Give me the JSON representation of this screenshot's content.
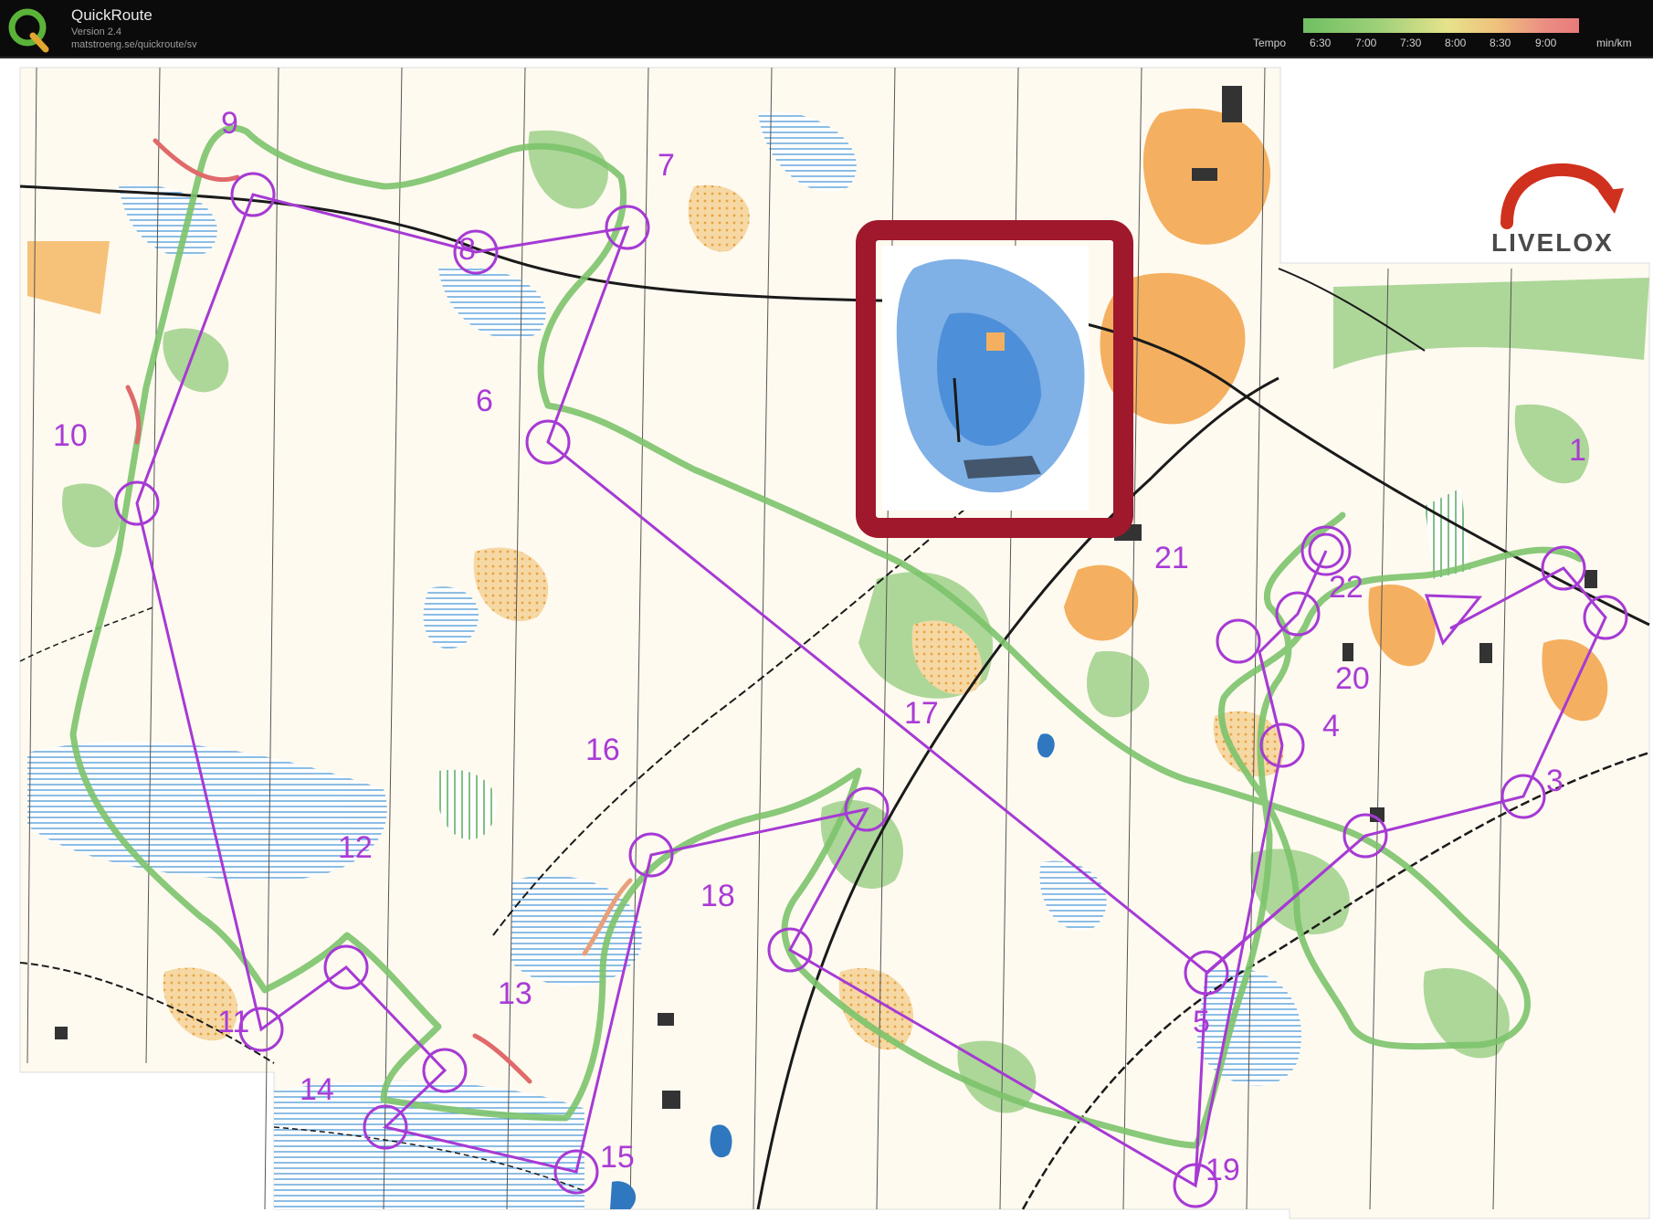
{
  "app": {
    "title": "QuickRoute",
    "version": "Version 2.4",
    "url": "matstroeng.se/quickroute/sv"
  },
  "tempo": {
    "label": "Tempo",
    "ticks": [
      "6:30",
      "7:00",
      "7:30",
      "8:00",
      "8:30",
      "9:00"
    ],
    "unit": "min/km"
  },
  "brand": {
    "name": "LIVELOX"
  },
  "colors": {
    "course": "#a63ad4",
    "highlight": "#a0182c",
    "route_fast": "#6fbf62",
    "route_slow": "#e06a6a"
  },
  "controls": [
    {
      "label": "1"
    },
    {
      "label": "3"
    },
    {
      "label": "4"
    },
    {
      "label": "5"
    },
    {
      "label": "6"
    },
    {
      "label": "7"
    },
    {
      "label": "8"
    },
    {
      "label": "9"
    },
    {
      "label": "10"
    },
    {
      "label": "11"
    },
    {
      "label": "12"
    },
    {
      "label": "13"
    },
    {
      "label": "14"
    },
    {
      "label": "15"
    },
    {
      "label": "16"
    },
    {
      "label": "17"
    },
    {
      "label": "18"
    },
    {
      "label": "19"
    },
    {
      "label": "20"
    },
    {
      "label": "21"
    },
    {
      "label": "22"
    }
  ]
}
